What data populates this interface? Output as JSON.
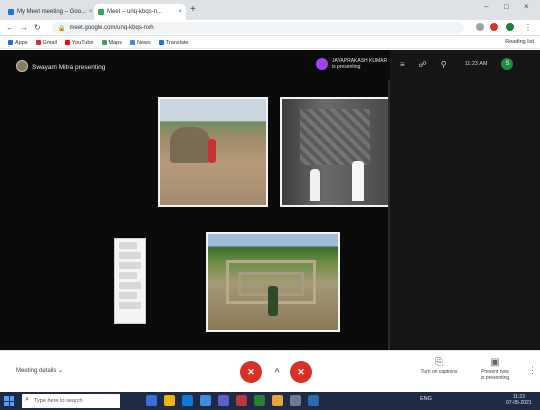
{
  "browser": {
    "tabs": [
      {
        "label": "My Meet meeting – Goo..."
      },
      {
        "label": "Meet – unq-kbqs-n..."
      }
    ],
    "new_tab_symbol": "+",
    "window_controls": {
      "minimize": "–",
      "maximize": "□",
      "close": "×"
    },
    "nav": {
      "back": "←",
      "forward": "→",
      "reload": "↻"
    },
    "address": "meet.google.com/unq-kbqs-nxh",
    "bookmarks": [
      "Apps",
      "Gmail",
      "YouTube",
      "Maps",
      "News",
      "Translate"
    ],
    "bookmarks_right": "Reading list"
  },
  "meeting": {
    "title": "Swayam Mitra presenting",
    "presenter": {
      "name": "JAYAPRAKASH KUMAR",
      "subtitle": "is presenting"
    },
    "right_panel": {
      "time": "11:23 AM",
      "user_initial": "S"
    }
  },
  "toolbar": {
    "meeting_details": "Meeting details",
    "end_call_symbol": "✕",
    "mic_symbol": "✕",
    "raise_hand_symbol": "^",
    "turn_on_captions": "Turn on captions",
    "present_now": "Present now",
    "present_now_sub": "is presenting",
    "more_symbol": "⋮"
  },
  "taskbar": {
    "search_placeholder": "Type here to search",
    "tray_text": "ENG",
    "clock_time": "11:23",
    "clock_date": "07-05-2021"
  }
}
